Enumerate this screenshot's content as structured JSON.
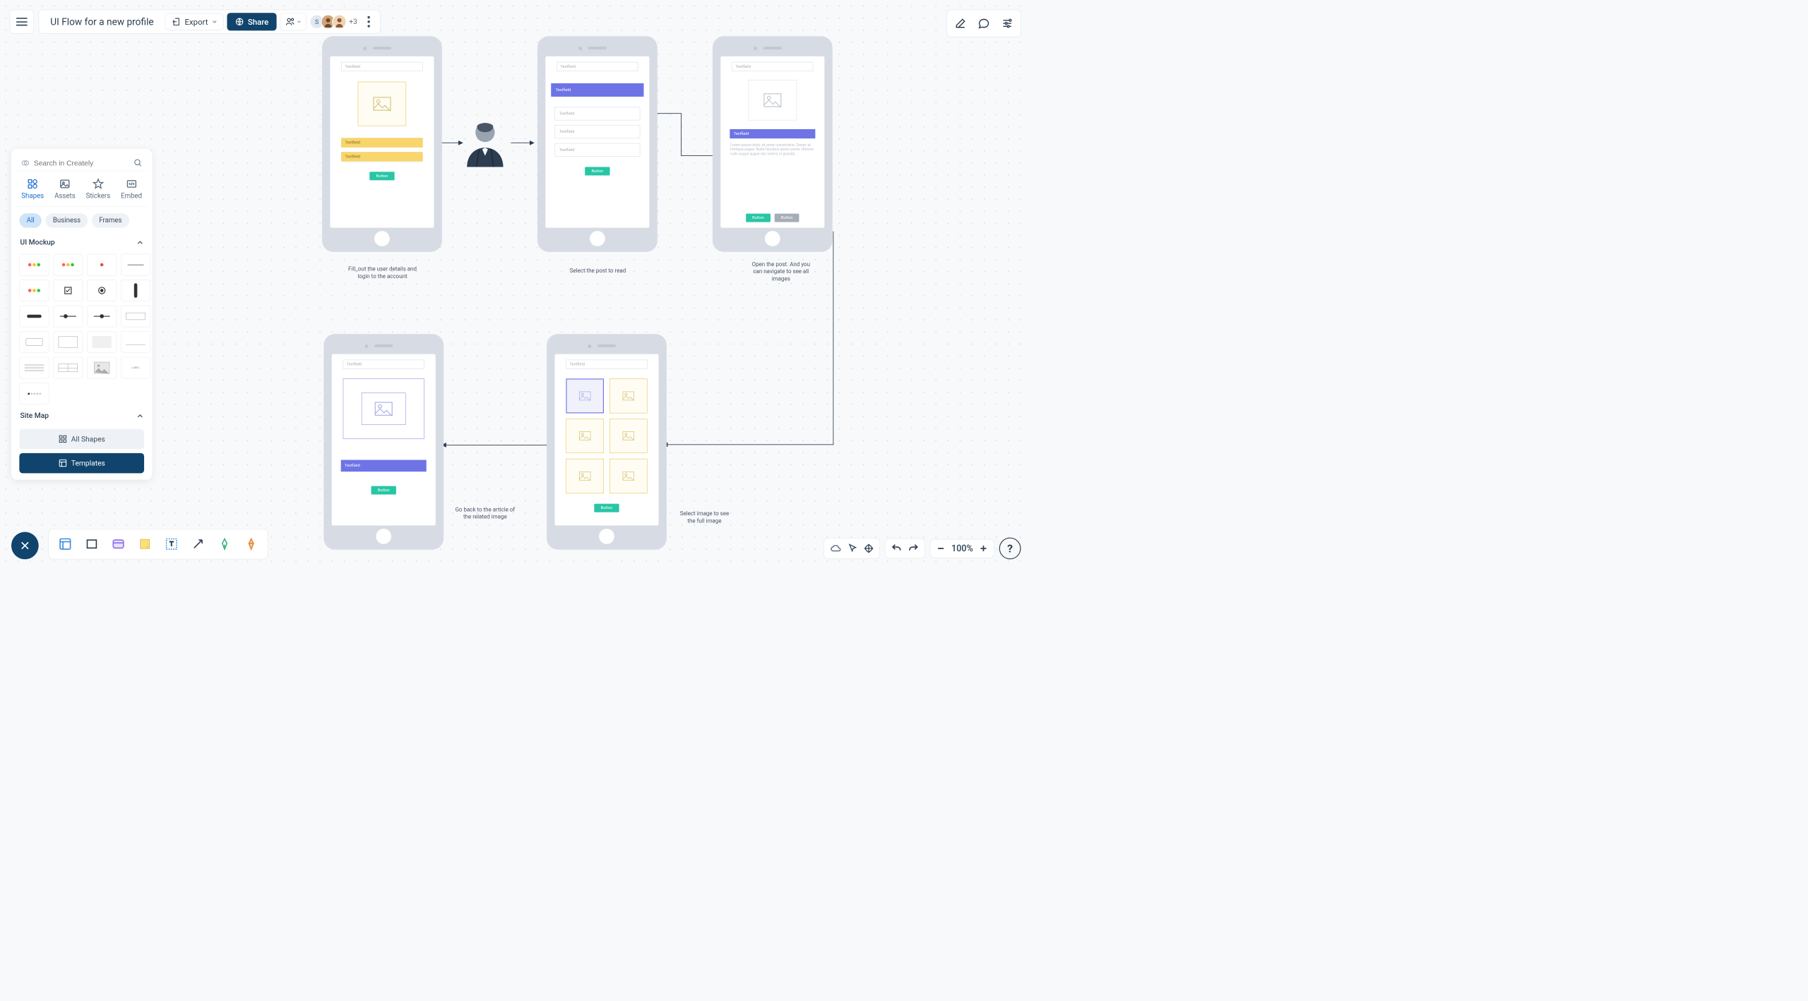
{
  "document": {
    "title": "UI Flow for a new profile"
  },
  "toolbar": {
    "export_label": "Export",
    "share_label": "Share",
    "more_avatars": "+3",
    "avatar1_initial": "S"
  },
  "panel": {
    "search_placeholder": "Search in Creately",
    "tabs": {
      "shapes": "Shapes",
      "assets": "Assets",
      "stickers": "Stickers",
      "embed": "Embed"
    },
    "chips": {
      "all": "All",
      "business": "Business",
      "frames": "Frames"
    },
    "sections": {
      "ui_mockup": "UI Mockup",
      "site_map": "Site Map"
    },
    "all_shapes": "All Shapes",
    "templates": "Templates"
  },
  "zoom": {
    "percent": "100%"
  },
  "canvas": {
    "field_label": "Textfield",
    "button_label": "Button",
    "lorem": "Lorem ipsum dolor sit amet consectetur. Donec at tristique augue. Nulla faucibus ipsum porta. Ultrices nulla augue augue nec viverra or gravida.",
    "captions": {
      "c1": "Fill_out the user details and login to the account",
      "c2": "Select the post to read",
      "c3": "Open the post. And you can navigate to see all images",
      "c4": "Go back to the article of the related image",
      "c5": "Select image to see the full image"
    }
  }
}
